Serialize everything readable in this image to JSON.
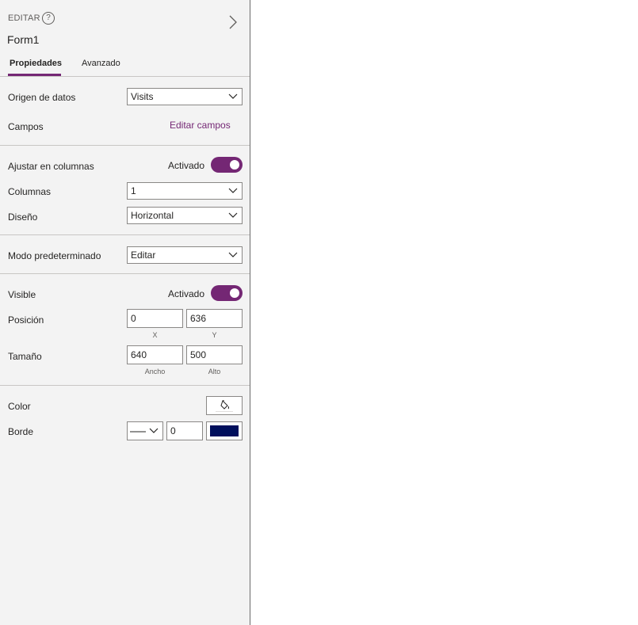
{
  "header": {
    "mode_label": "EDITAR",
    "help_icon": "?",
    "form_name": "Form1"
  },
  "tabs": [
    {
      "label": "Propiedades",
      "active": true
    },
    {
      "label": "Avanzado",
      "active": false
    }
  ],
  "data_section": {
    "data_source_label": "Origen de datos",
    "data_source_value": "Visits",
    "fields_label": "Campos",
    "edit_fields_link": "Editar campos"
  },
  "layout_section": {
    "snap_label": "Ajustar en columnas",
    "snap_state": "Activado",
    "snap_on": true,
    "columns_label": "Columnas",
    "columns_value": "1",
    "design_label": "Diseño",
    "design_value": "Horizontal"
  },
  "mode_section": {
    "default_mode_label": "Modo predeterminado",
    "default_mode_value": "Editar"
  },
  "display_section": {
    "visible_label": "Visible",
    "visible_state": "Activado",
    "visible_on": true,
    "position_label": "Posición",
    "position_x": "0",
    "position_y": "636",
    "x_caption": "X",
    "y_caption": "Y",
    "size_label": "Tamaño",
    "width": "640",
    "height": "500",
    "width_caption": "Ancho",
    "height_caption": "Alto"
  },
  "style_section": {
    "color_label": "Color",
    "border_label": "Borde",
    "border_width": "0",
    "border_color": "#000f5c"
  },
  "colors": {
    "accent": "#742774"
  }
}
